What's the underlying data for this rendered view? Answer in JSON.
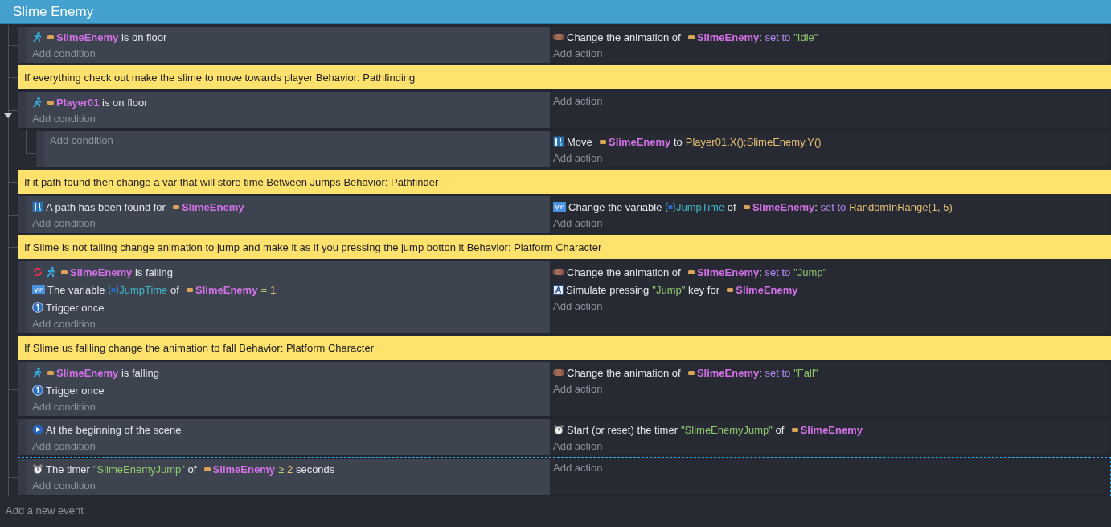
{
  "title": "Slime Enemy",
  "events": [
    {
      "kind": "standard",
      "selected": false,
      "conditions": [
        {
          "kind": "platformer",
          "inverted": false,
          "parts": [
            {
              "kind": "object",
              "text": "SlimeEnemy"
            },
            {
              "kind": "text",
              "text": " is on floor"
            }
          ]
        }
      ],
      "add_condition": "Add condition",
      "actions": [
        {
          "kind": "animation",
          "parts": [
            {
              "kind": "text",
              "text": "Change the animation of  "
            },
            {
              "kind": "object",
              "text": "SlimeEnemy"
            },
            {
              "kind": "text",
              "text": ": "
            },
            {
              "kind": "keyword",
              "text": "set to"
            },
            {
              "kind": "string",
              "text": "\"Idle\""
            }
          ]
        }
      ],
      "add_action": "Add action"
    },
    {
      "kind": "comment",
      "selected": false,
      "text": "If everything check out make the slime to move towards player Behavior: Pathfinding"
    },
    {
      "kind": "standard",
      "selected": false,
      "expanded": true,
      "conditions": [
        {
          "kind": "platformer",
          "inverted": false,
          "parts": [
            {
              "kind": "object",
              "text": "Player01"
            },
            {
              "kind": "text",
              "text": " is on floor"
            }
          ]
        }
      ],
      "add_condition": "Add condition",
      "add_action": "Add action",
      "children": [
        {
          "kind": "standard",
          "selected": false,
          "add_condition": "Add condition",
          "actions": [
            {
              "kind": "pathfinding",
              "parts": [
                {
                  "kind": "text",
                  "text": "Move  "
                },
                {
                  "kind": "object",
                  "text": "SlimeEnemy"
                },
                {
                  "kind": "text",
                  "text": " to"
                },
                {
                  "kind": "expression",
                  "text": "Player01.X();SlimeEnemy.Y()"
                }
              ]
            }
          ],
          "add_action": "Add action"
        }
      ]
    },
    {
      "kind": "comment",
      "selected": false,
      "text": "If it path found then change a var that will store time Between Jumps Behavior: Pathfinder"
    },
    {
      "kind": "standard",
      "selected": false,
      "conditions": [
        {
          "kind": "pathfinding",
          "inverted": false,
          "parts": [
            {
              "kind": "text",
              "text": "A path has been found for  "
            },
            {
              "kind": "object",
              "text": "SlimeEnemy"
            }
          ]
        }
      ],
      "add_condition": "Add condition",
      "actions": [
        {
          "kind": "variable",
          "parts": [
            {
              "kind": "text",
              "text": "Change the variable "
            },
            {
              "kind": "variable",
              "text": "JumpTime"
            },
            {
              "kind": "text",
              "text": " of  "
            },
            {
              "kind": "object",
              "text": "SlimeEnemy"
            },
            {
              "kind": "text",
              "text": ": "
            },
            {
              "kind": "keyword",
              "text": "set to"
            },
            {
              "kind": "expression",
              "text": "RandomInRange(1, 5)"
            }
          ]
        }
      ],
      "add_action": "Add action"
    },
    {
      "kind": "comment",
      "selected": false,
      "text": "If Slime is not falling change animation to jump and make it as if you pressing the jump botton it Behavior: Platform Character"
    },
    {
      "kind": "standard",
      "selected": false,
      "conditions": [
        {
          "kind": "platformer",
          "inverted": true,
          "parts": [
            {
              "kind": "object",
              "text": "SlimeEnemy"
            },
            {
              "kind": "text",
              "text": " is falling"
            }
          ]
        },
        {
          "kind": "variable",
          "inverted": false,
          "parts": [
            {
              "kind": "text",
              "text": "The variable "
            },
            {
              "kind": "variable",
              "text": "JumpTime"
            },
            {
              "kind": "text",
              "text": " of  "
            },
            {
              "kind": "object",
              "text": "SlimeEnemy"
            },
            {
              "kind": "operator",
              "text": "="
            },
            {
              "kind": "expression",
              "text": "1"
            }
          ]
        },
        {
          "kind": "trigger",
          "inverted": false,
          "parts": [
            {
              "kind": "text",
              "text": "Trigger once"
            }
          ]
        }
      ],
      "add_condition": "Add condition",
      "actions": [
        {
          "kind": "animation",
          "parts": [
            {
              "kind": "text",
              "text": "Change the animation of  "
            },
            {
              "kind": "object",
              "text": "SlimeEnemy"
            },
            {
              "kind": "text",
              "text": ": "
            },
            {
              "kind": "keyword",
              "text": "set to"
            },
            {
              "kind": "string",
              "text": "\"Jump\""
            }
          ]
        },
        {
          "kind": "key",
          "parts": [
            {
              "kind": "text",
              "text": "Simulate pressing"
            },
            {
              "kind": "string",
              "text": "\"Jump\""
            },
            {
              "kind": "text",
              "text": " key for  "
            },
            {
              "kind": "object",
              "text": "SlimeEnemy"
            }
          ]
        }
      ],
      "add_action": "Add action"
    },
    {
      "kind": "comment",
      "selected": false,
      "text": "If Slime us fallling change the animation to fall Behavior: Platform Character"
    },
    {
      "kind": "standard",
      "selected": false,
      "conditions": [
        {
          "kind": "platformer",
          "inverted": false,
          "parts": [
            {
              "kind": "object",
              "text": "SlimeEnemy"
            },
            {
              "kind": "text",
              "text": " is falling"
            }
          ]
        },
        {
          "kind": "trigger",
          "inverted": false,
          "parts": [
            {
              "kind": "text",
              "text": "Trigger once"
            }
          ]
        }
      ],
      "add_condition": "Add condition",
      "actions": [
        {
          "kind": "animation",
          "parts": [
            {
              "kind": "text",
              "text": "Change the animation of  "
            },
            {
              "kind": "object",
              "text": "SlimeEnemy"
            },
            {
              "kind": "text",
              "text": ": "
            },
            {
              "kind": "keyword",
              "text": "set to"
            },
            {
              "kind": "string",
              "text": "\"Fall\""
            }
          ]
        }
      ],
      "add_action": "Add action"
    },
    {
      "kind": "standard",
      "selected": false,
      "conditions": [
        {
          "kind": "scene-start",
          "inverted": false,
          "parts": [
            {
              "kind": "text",
              "text": "At the beginning of the scene"
            }
          ]
        }
      ],
      "add_condition": "Add condition",
      "actions": [
        {
          "kind": "timer",
          "parts": [
            {
              "kind": "text",
              "text": "Start (or reset) the timer"
            },
            {
              "kind": "string",
              "text": "\"SlimeEnemyJump\""
            },
            {
              "kind": "text",
              "text": " of  "
            },
            {
              "kind": "object",
              "text": "SlimeEnemy"
            }
          ]
        }
      ],
      "add_action": "Add action"
    },
    {
      "kind": "standard",
      "selected": true,
      "conditions": [
        {
          "kind": "timer",
          "inverted": false,
          "parts": [
            {
              "kind": "text",
              "text": "The timer"
            },
            {
              "kind": "string",
              "text": "\"SlimeEnemyJump\""
            },
            {
              "kind": "text",
              "text": " of  "
            },
            {
              "kind": "object",
              "text": "SlimeEnemy"
            },
            {
              "kind": "operator",
              "text": "≥"
            },
            {
              "kind": "expression",
              "text": "2"
            },
            {
              "kind": "text",
              "text": " seconds"
            }
          ]
        }
      ],
      "add_condition": "Add condition",
      "add_action": "Add action"
    }
  ],
  "add_event": "Add a new event"
}
